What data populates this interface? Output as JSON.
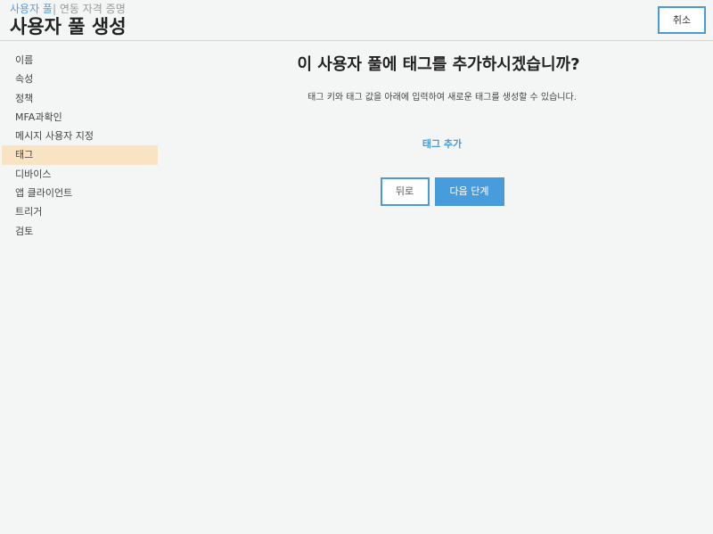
{
  "header": {
    "breadcrumb_link": "사용자 풀",
    "breadcrumb_sep": "|",
    "breadcrumb_current": "연동 자격 증명",
    "title": "사용자 풀 생성",
    "cancel_label": "취소"
  },
  "sidebar": {
    "items": [
      {
        "label": "이름"
      },
      {
        "label": "속성"
      },
      {
        "label": "정책"
      },
      {
        "label": "MFA과확인"
      },
      {
        "label": "메시지 사용자 지정"
      },
      {
        "label": "태그"
      },
      {
        "label": "디바이스"
      },
      {
        "label": "앱 클라이언트"
      },
      {
        "label": "트리거"
      },
      {
        "label": "검토"
      }
    ],
    "active_index": 5
  },
  "main": {
    "heading": "이 사용자 풀에 태그를 추가하시겠습니까?",
    "description": "태그 키와 태그 값을 아래에 입력하여 새로운 태그를 생성할 수 있습니다.",
    "add_tag_label": "태그 추가",
    "back_label": "뒤로",
    "next_label": "다음 단계"
  },
  "colors": {
    "accent": "#479ddb",
    "active_bg": "#f8e3c3"
  }
}
